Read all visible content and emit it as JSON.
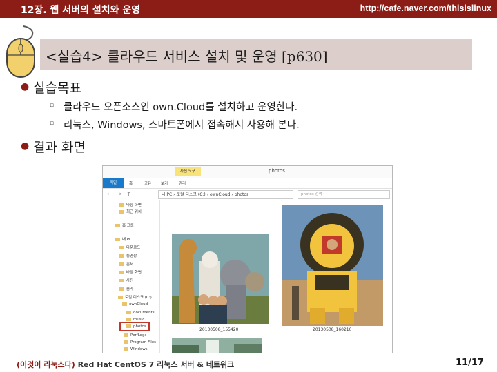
{
  "header": {
    "chapter": "12장. 웹 서버의 설치와 운영",
    "url": "http://cafe.naver.com/thisislinux",
    "bar_color": "#8c1c16"
  },
  "slide": {
    "title": "<실습4> 클라우드 서비스 설치 및 운영 [p630]",
    "bullet_icon": "bullet-dot",
    "sub_bullet_icon": "hollow-square",
    "sections": [
      {
        "heading": "실습목표",
        "items": [
          "클라우드 오픈소스인 own.Cloud를 설치하고 운영한다.",
          "리눅스, Windows, 스마트폰에서 접속해서 사용해 본다."
        ]
      },
      {
        "heading": "결과 화면",
        "items": []
      }
    ]
  },
  "screenshot": {
    "window_caption": "photos",
    "tool_tab": "사진 도구",
    "ribbon_tabs": [
      "파일",
      "홈",
      "공유",
      "보기",
      "관리"
    ],
    "address_path": "내 PC › 로컬 디스크 (C:) › ownCloud › photos",
    "search_placeholder": "photos 검색",
    "sidebar": [
      "바탕 화면",
      "최근 위치",
      "홈 그룹",
      "내 PC",
      "다운로드",
      "동영상",
      "문서",
      "바탕 화면",
      "사진",
      "음악",
      "로컬 디스크 (C:)",
      "ownCloud",
      "documents",
      "music",
      "photos",
      "PerfLogs",
      "Program Files",
      "Windows"
    ],
    "selected_folder": "photos",
    "photos": [
      {
        "caption": "20130508_155420"
      },
      {
        "caption": "20130508_160210"
      }
    ]
  },
  "footer": {
    "book_prefix": "(이것이 리눅스다)",
    "book_rest": " Red Hat CentOS 7 리눅스 서버 & 네트워크",
    "page": "11/17"
  }
}
